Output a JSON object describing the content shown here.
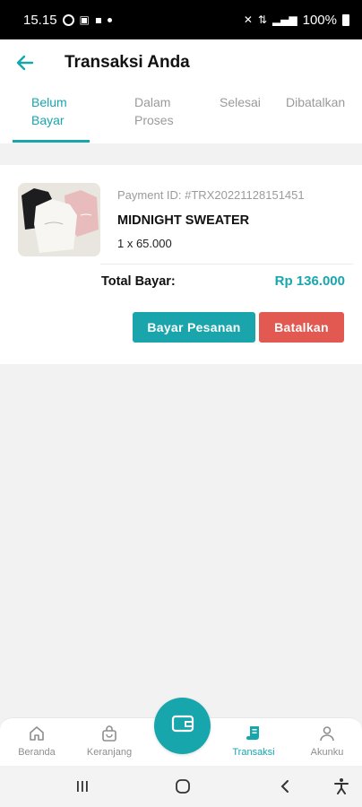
{
  "status_bar": {
    "time": "15.15",
    "battery": "100%"
  },
  "header": {
    "title": "Transaksi Anda"
  },
  "tabs": [
    {
      "label": "Belum\nBayar",
      "active": true
    },
    {
      "label": "Dalam\nProses",
      "active": false
    },
    {
      "label": "Selesai",
      "active": false
    },
    {
      "label": "Dibatalkan",
      "active": false
    }
  ],
  "order": {
    "payment_id": "Payment ID: #TRX20221128151451",
    "product_name": "MIDNIGHT SWEATER",
    "quantity": "1 x 65.000",
    "total_label": "Total Bayar:",
    "total_value": "Rp 136.000",
    "pay_button": "Bayar Pesanan",
    "cancel_button": "Batalkan"
  },
  "bottom_nav": {
    "items": [
      {
        "label": "Beranda",
        "icon": "home-icon",
        "active": false
      },
      {
        "label": "Keranjang",
        "icon": "shopping-bag-icon",
        "active": false
      },
      {
        "label": "Transaksi",
        "icon": "receipt-icon",
        "active": true
      },
      {
        "label": "Akunku",
        "icon": "user-icon",
        "active": false
      }
    ],
    "fab_icon": "wallet-icon"
  },
  "colors": {
    "accent": "#18a6ad",
    "danger": "#e15951"
  }
}
